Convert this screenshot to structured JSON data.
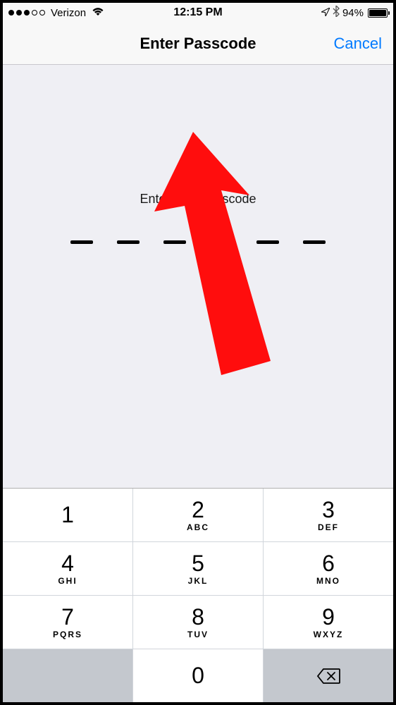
{
  "status": {
    "carrier": "Verizon",
    "time": "12:15 PM",
    "battery_percent": "94%",
    "battery_level_width": "94%"
  },
  "nav": {
    "title": "Enter Passcode",
    "cancel": "Cancel"
  },
  "main": {
    "prompt": "Enter your passcode",
    "passcode_length": 6
  },
  "keypad": {
    "keys": [
      {
        "digit": "1",
        "letters": ""
      },
      {
        "digit": "2",
        "letters": "ABC"
      },
      {
        "digit": "3",
        "letters": "DEF"
      },
      {
        "digit": "4",
        "letters": "GHI"
      },
      {
        "digit": "5",
        "letters": "JKL"
      },
      {
        "digit": "6",
        "letters": "MNO"
      },
      {
        "digit": "7",
        "letters": "PQRS"
      },
      {
        "digit": "8",
        "letters": "TUV"
      },
      {
        "digit": "9",
        "letters": "WXYZ"
      },
      {
        "digit": "0",
        "letters": ""
      }
    ]
  },
  "colors": {
    "accent": "#007aff",
    "bg": "#efeff4",
    "annotation": "#ff0d0d"
  }
}
